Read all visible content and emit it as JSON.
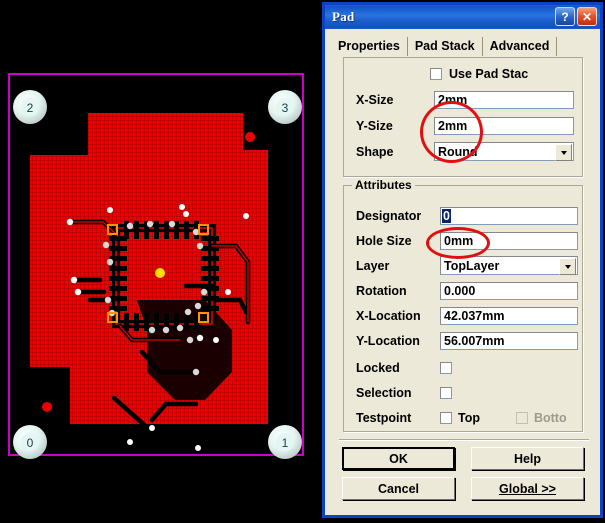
{
  "dialog": {
    "title": "Pad",
    "titlebar_buttons": [
      {
        "name": "help-button",
        "glyph": "?"
      },
      {
        "name": "close-button",
        "glyph": "✕"
      }
    ],
    "tabs": [
      {
        "label": "Properties",
        "active": true
      },
      {
        "label": "Pad Stack",
        "active": false
      },
      {
        "label": "Advanced",
        "active": false
      }
    ],
    "size_group": {
      "use_pad_stack": {
        "label": "Use Pad Stac",
        "checked": false
      },
      "fields": [
        {
          "label": "X-Size",
          "value": "2mm",
          "type": "text"
        },
        {
          "label": "Y-Size",
          "value": "2mm",
          "type": "text"
        },
        {
          "label": "Shape",
          "value": "Round",
          "type": "combo"
        }
      ]
    },
    "attributes_group": {
      "caption": "Attributes",
      "designator": {
        "label": "Designator",
        "value": "0",
        "selected": true
      },
      "hole_size": {
        "label": "Hole Size",
        "value": "0mm"
      },
      "layer": {
        "label": "Layer",
        "value": "TopLayer"
      },
      "rotation": {
        "label": "Rotation",
        "value": "0.000"
      },
      "x_location": {
        "label": "X-Location",
        "value": "42.037mm"
      },
      "y_location": {
        "label": "Y-Location",
        "value": "56.007mm"
      },
      "locked": {
        "label": "Locked",
        "checked": false
      },
      "selection": {
        "label": "Selection",
        "checked": false
      },
      "testpoint": {
        "label": "Testpoint",
        "top": {
          "label": "Top",
          "checked": false,
          "enabled": true
        },
        "bottom": {
          "label": "Botto",
          "checked": false,
          "enabled": false
        }
      }
    },
    "buttons": [
      {
        "name": "ok-button",
        "label": "OK",
        "default": true
      },
      {
        "name": "help-button-2",
        "label": "Help",
        "default": false
      },
      {
        "name": "cancel-button",
        "label": "Cancel",
        "default": false
      },
      {
        "name": "global-button",
        "label": "Global >>",
        "default": false,
        "accel": "G"
      }
    ]
  },
  "annotations": {
    "color": "#e01010",
    "ellipses": [
      {
        "name": "size-highlight",
        "target": "x-size-and-y-size"
      },
      {
        "name": "hole-size-highlight",
        "target": "hole-size"
      }
    ]
  },
  "pcb": {
    "name": "pcb-layout-view",
    "colors": {
      "background": "#000000",
      "board_outline": "#cc00cc",
      "copper_fill": "#ef0000",
      "pad_silk": "#d8f2ee",
      "selected_pad": "#ffe000",
      "via": "#ffffff",
      "marker": "#ff8800"
    },
    "corner_pads": [
      {
        "label": "2",
        "corner": "top-left"
      },
      {
        "label": "3",
        "corner": "top-right"
      },
      {
        "label": "0",
        "corner": "bottom-left"
      },
      {
        "label": "1",
        "corner": "bottom-right"
      }
    ]
  }
}
